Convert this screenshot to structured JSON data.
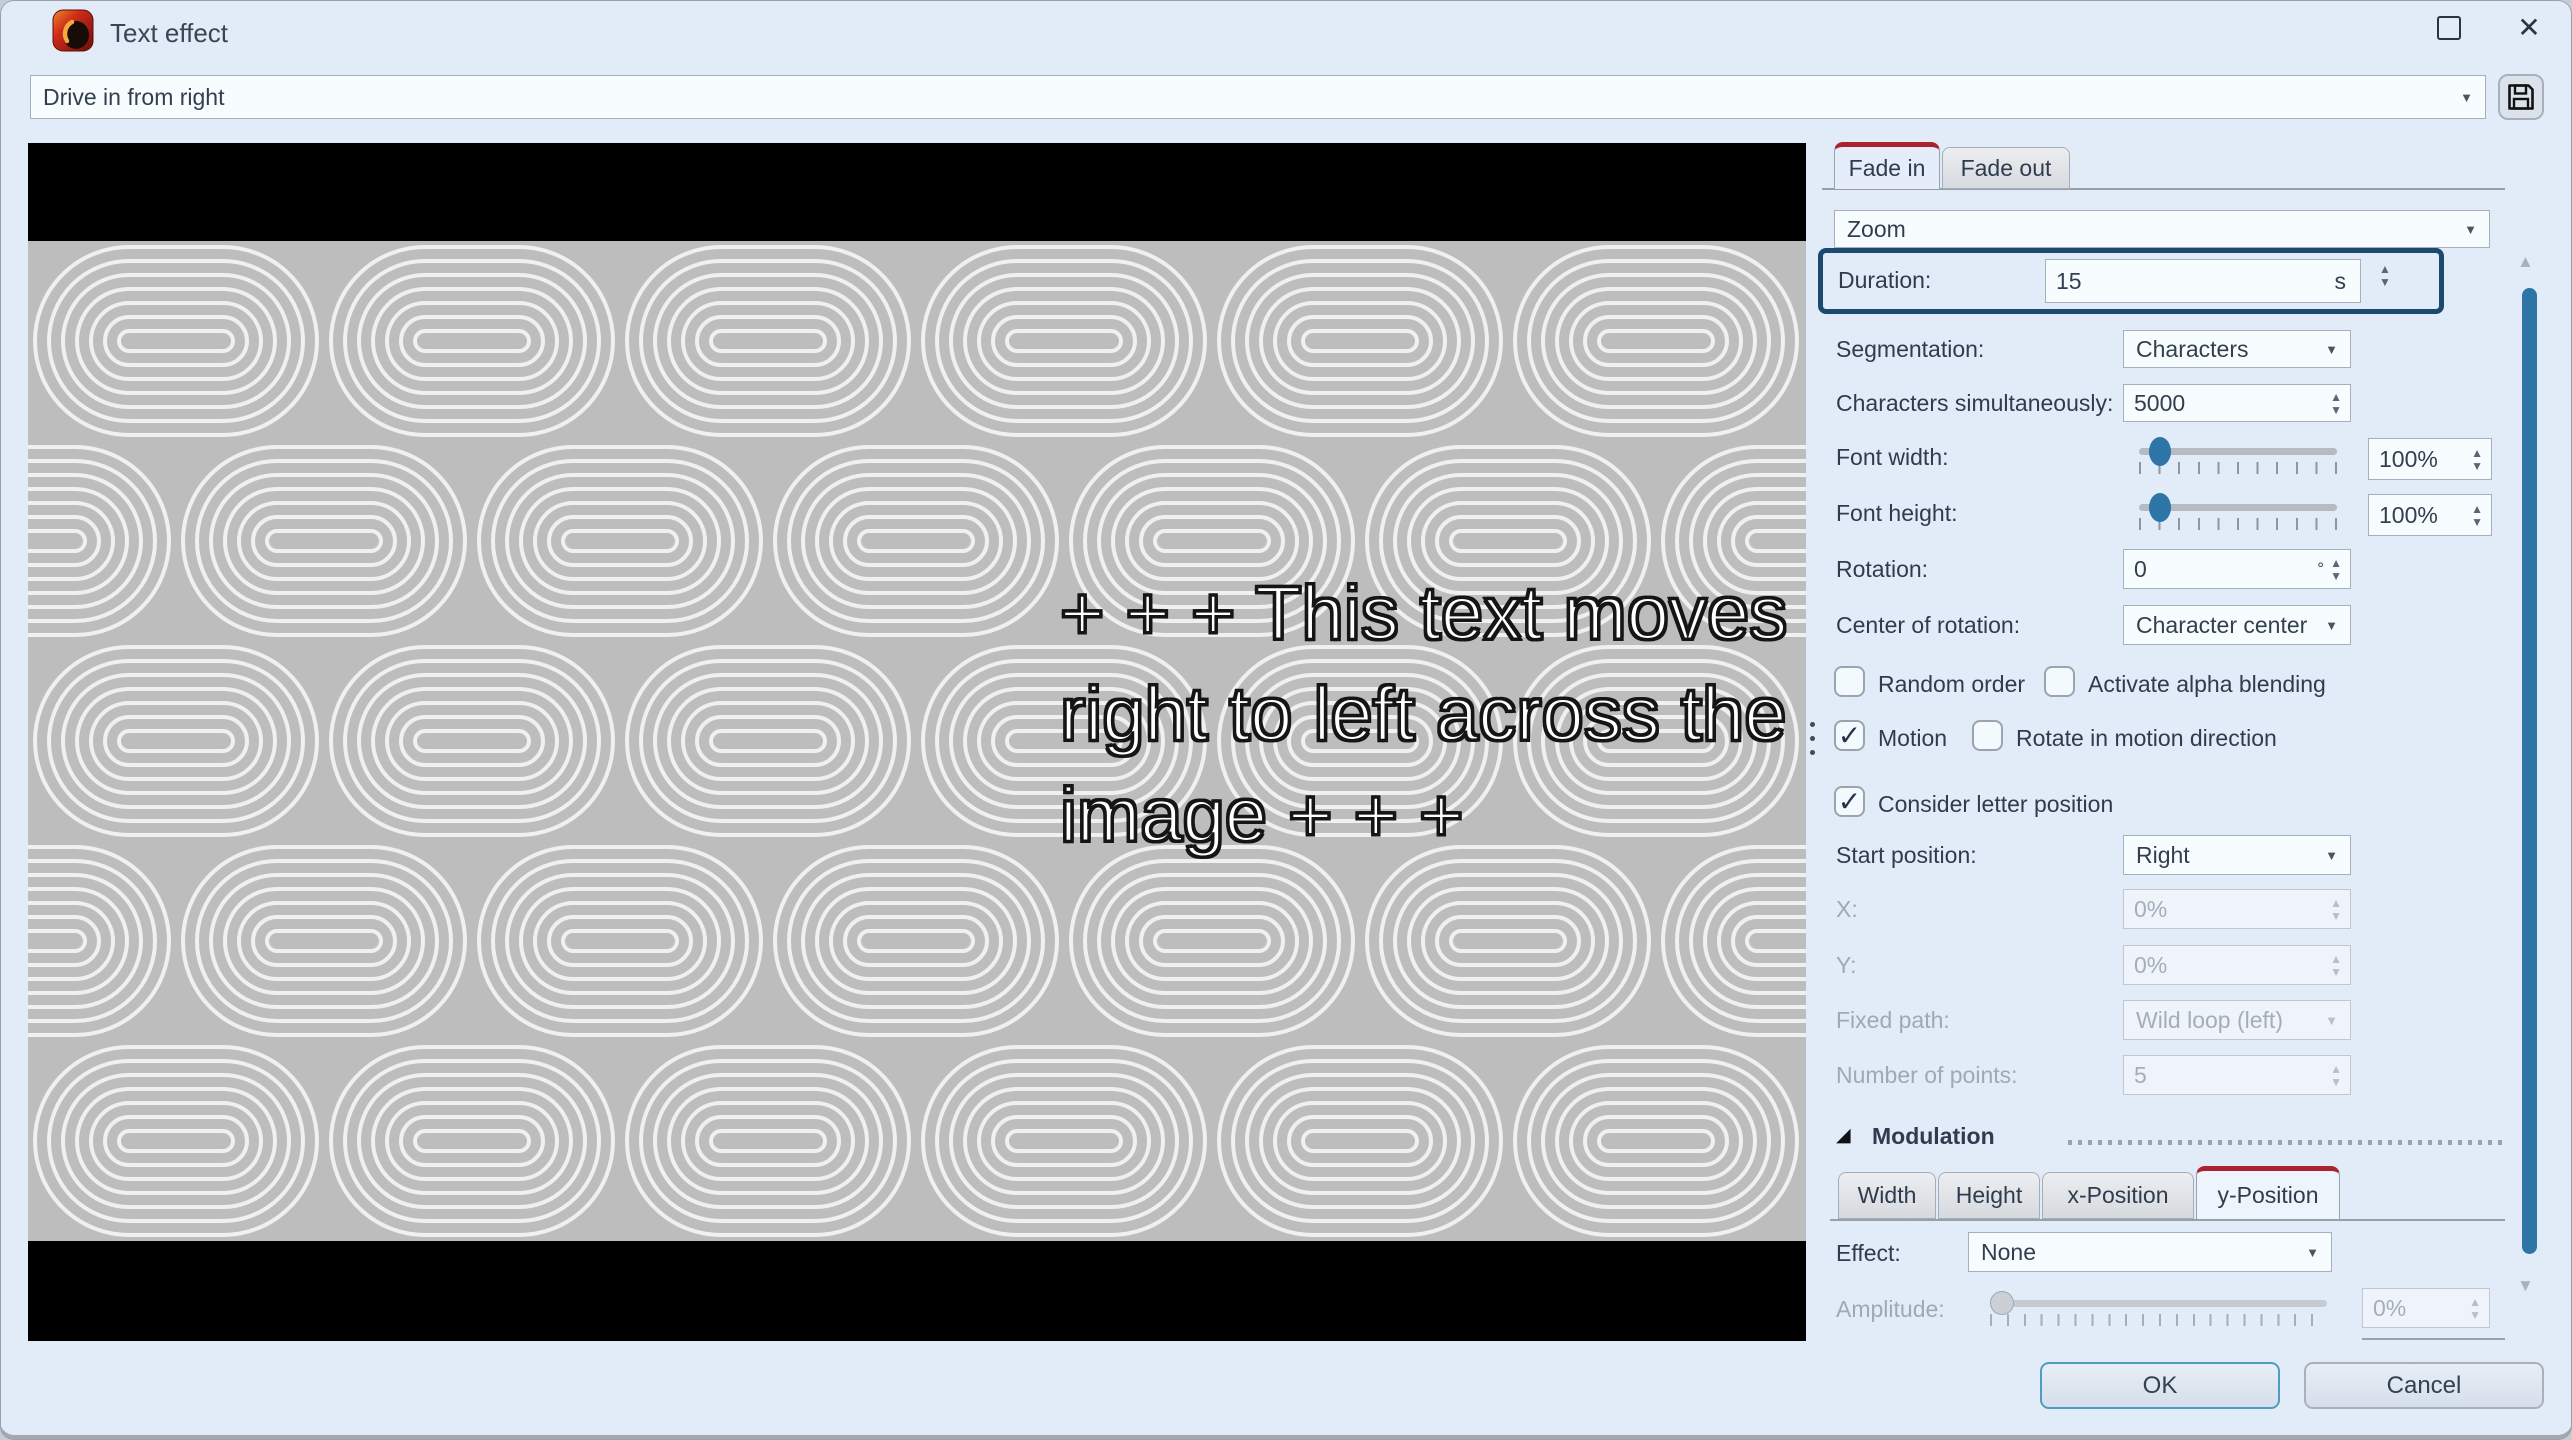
{
  "window": {
    "title": "Text effect"
  },
  "icons": {
    "dropdown_arrow": "▼",
    "spinner_up": "▲",
    "spinner_down": "▼",
    "check": "✓",
    "collapse_triangle": "◢",
    "scrollbar_up": "▲",
    "scrollbar_down": "▼",
    "close": "✕"
  },
  "preset": {
    "value": "Drive in from right"
  },
  "preview": {
    "text_lines": [
      "+ + + This text moves",
      "right to left across the",
      "image + + +"
    ]
  },
  "fade_tabs": {
    "fade_in": "Fade in",
    "fade_out": "Fade out"
  },
  "effect_select": {
    "value": "Zoom"
  },
  "duration": {
    "label": "Duration:",
    "value": "15",
    "unit": "s"
  },
  "segmentation": {
    "label": "Segmentation:",
    "value": "Characters"
  },
  "chars_simultaneously": {
    "label": "Characters simultaneously:",
    "value": "5000"
  },
  "font_width": {
    "label": "Font width:",
    "value": "100%",
    "slider_percent": 10
  },
  "font_height": {
    "label": "Font height:",
    "value": "100%",
    "slider_percent": 10
  },
  "rotation": {
    "label": "Rotation:",
    "value": "0",
    "unit": "°"
  },
  "center_of_rotation": {
    "label": "Center of rotation:",
    "value": "Character center"
  },
  "checkboxes": {
    "random_order": {
      "label": "Random order",
      "checked": false
    },
    "activate_alpha_blending": {
      "label": "Activate alpha blending",
      "checked": false
    },
    "motion": {
      "label": "Motion",
      "checked": true
    },
    "rotate_in_motion_direction": {
      "label": "Rotate in motion direction",
      "checked": false
    },
    "consider_letter_position": {
      "label": "Consider letter position",
      "checked": true
    }
  },
  "start_position": {
    "label": "Start position:",
    "value": "Right"
  },
  "x_position": {
    "label": "X:",
    "value": "0%",
    "disabled": true
  },
  "y_position": {
    "label": "Y:",
    "value": "0%",
    "disabled": true
  },
  "fixed_path": {
    "label": "Fixed path:",
    "value": "Wild loop (left)",
    "disabled": true
  },
  "number_of_points": {
    "label": "Number of points:",
    "value": "5",
    "disabled": true
  },
  "modulation": {
    "header": "Modulation",
    "tabs": [
      "Width",
      "Height",
      "x-Position",
      "y-Position"
    ],
    "active_tab": "y-Position",
    "effect": {
      "label": "Effect:",
      "value": "None"
    },
    "amplitude": {
      "label": "Amplitude:",
      "value": "0%",
      "slider_percent": 0,
      "disabled": true
    }
  },
  "buttons": {
    "ok": "OK",
    "cancel": "Cancel"
  },
  "colors": {
    "accent_red": "#a92430",
    "focus_border": "#1b4a6e",
    "scrollbar_thumb": "#2d74a7",
    "slider_thumb": "#2d74a7",
    "preview_bg": "#bdbdbd",
    "pattern_line": "#f8f8f8",
    "dialog_bg": "#e2ebf8"
  }
}
